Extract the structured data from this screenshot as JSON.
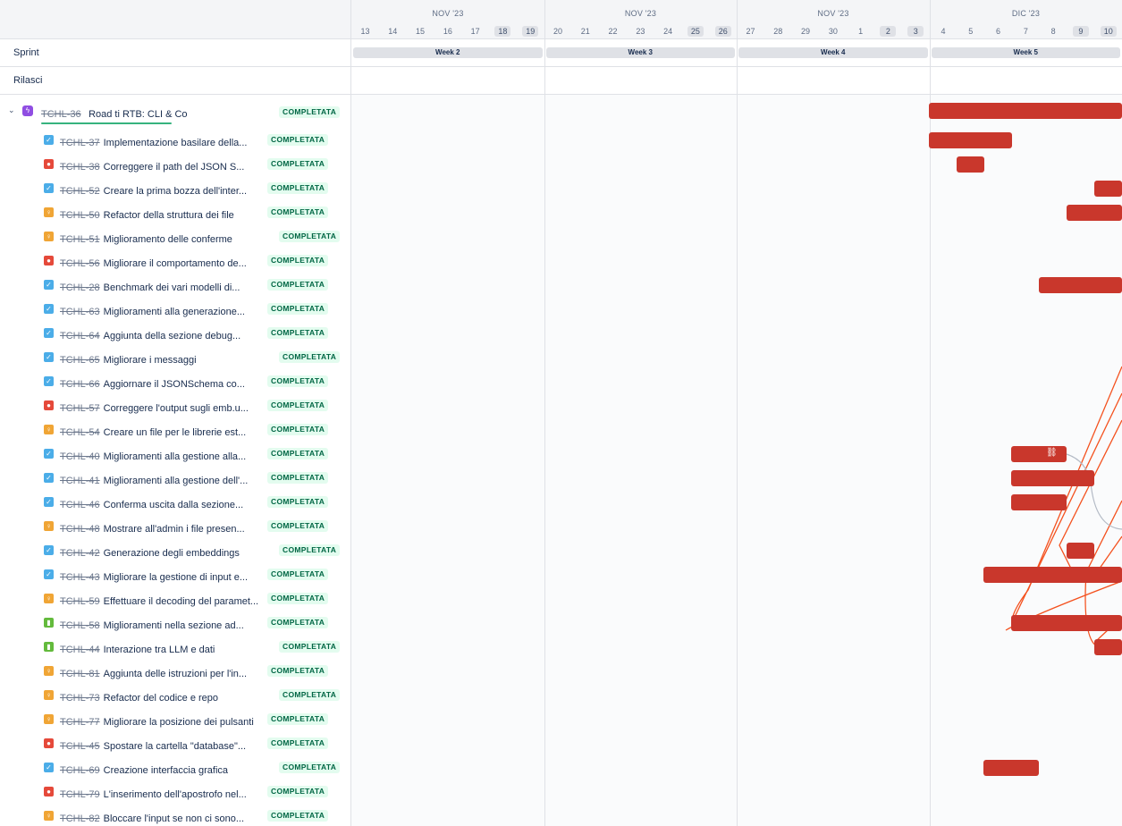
{
  "header": {
    "months": [
      "NOV '23",
      "NOV '23",
      "NOV '23",
      "DIC '23"
    ],
    "days": [
      "13",
      "14",
      "15",
      "16",
      "17",
      "18",
      "19",
      "20",
      "21",
      "22",
      "23",
      "24",
      "25",
      "26",
      "27",
      "28",
      "29",
      "30",
      "1",
      "2",
      "3",
      "4",
      "5",
      "6",
      "7",
      "8",
      "9",
      "10"
    ],
    "weekends": [
      5,
      6,
      12,
      13,
      19,
      20,
      26,
      27
    ]
  },
  "sprint": {
    "label": "Sprint",
    "weeks": [
      "Week 2",
      "Week 3",
      "Week 4",
      "Week 5"
    ]
  },
  "rilasci": {
    "label": "Rilasci"
  },
  "epic": {
    "key": "TCHL-36",
    "summary": "Road ti RTB: CLI & Co",
    "status": "COMPLETATA",
    "icon": "epic-icon",
    "progress_percent": 100
  },
  "status_label": "COMPLETATA",
  "issues": [
    {
      "type": "task",
      "key": "TCHL-37",
      "summary": "Implementazione basilare della..."
    },
    {
      "type": "bug",
      "key": "TCHL-38",
      "summary": "Correggere il path del JSON S..."
    },
    {
      "type": "task",
      "key": "TCHL-52",
      "summary": "Creare la prima bozza dell'inter..."
    },
    {
      "type": "subtask",
      "key": "TCHL-50",
      "summary": "Refactor della struttura dei file"
    },
    {
      "type": "subtask",
      "key": "TCHL-51",
      "summary": "Miglioramento delle conferme"
    },
    {
      "type": "bug",
      "key": "TCHL-56",
      "summary": "Migliorare il comportamento de..."
    },
    {
      "type": "task",
      "key": "TCHL-28",
      "summary": "Benchmark dei vari modelli di..."
    },
    {
      "type": "task",
      "key": "TCHL-63",
      "summary": "Miglioramenti alla generazione..."
    },
    {
      "type": "task",
      "key": "TCHL-64",
      "summary": "Aggiunta della sezione debug..."
    },
    {
      "type": "task",
      "key": "TCHL-65",
      "summary": "Migliorare i messaggi"
    },
    {
      "type": "task",
      "key": "TCHL-66",
      "summary": "Aggiornare il JSONSchema co..."
    },
    {
      "type": "bug",
      "key": "TCHL-57",
      "summary": "Correggere l'output sugli emb.u..."
    },
    {
      "type": "subtask",
      "key": "TCHL-54",
      "summary": "Creare un file per le librerie est..."
    },
    {
      "type": "task",
      "key": "TCHL-40",
      "summary": "Miglioramenti alla gestione alla..."
    },
    {
      "type": "task",
      "key": "TCHL-41",
      "summary": "Miglioramenti alla gestione dell'..."
    },
    {
      "type": "task",
      "key": "TCHL-46",
      "summary": "Conferma uscita dalla sezione..."
    },
    {
      "type": "subtask",
      "key": "TCHL-48",
      "summary": "Mostrare all'admin i file presen..."
    },
    {
      "type": "task",
      "key": "TCHL-42",
      "summary": "Generazione degli embeddings"
    },
    {
      "type": "task",
      "key": "TCHL-43",
      "summary": "Migliorare la gestione di input e..."
    },
    {
      "type": "subtask",
      "key": "TCHL-59",
      "summary": "Effettuare il decoding del paramet..."
    },
    {
      "type": "story",
      "key": "TCHL-58",
      "summary": "Miglioramenti nella sezione ad..."
    },
    {
      "type": "story",
      "key": "TCHL-44",
      "summary": "Interazione tra LLM e dati"
    },
    {
      "type": "subtask",
      "key": "TCHL-81",
      "summary": "Aggiunta delle istruzioni per l'in..."
    },
    {
      "type": "subtask",
      "key": "TCHL-73",
      "summary": "Refactor del codice e repo"
    },
    {
      "type": "subtask",
      "key": "TCHL-77",
      "summary": "Migliorare la posizione dei pulsanti"
    },
    {
      "type": "bug",
      "key": "TCHL-45",
      "summary": "Spostare la cartella \"database\"..."
    },
    {
      "type": "task",
      "key": "TCHL-69",
      "summary": "Creazione interfaccia grafica"
    },
    {
      "type": "bug",
      "key": "TCHL-79",
      "summary": "L'inserimento dell'apostrofo nel..."
    },
    {
      "type": "subtask",
      "key": "TCHL-82",
      "summary": "Bloccare l'input se non ci sono..."
    }
  ],
  "colors": {
    "bar": "#c9372c",
    "dependency_line": "#f4511e",
    "status_bg": "#e3fcef",
    "status_text": "#006644"
  },
  "icons": {
    "task": "checkbox-icon",
    "bug": "bug-icon",
    "subtask": "lightbulb-icon",
    "story": "bookmark-icon",
    "link": "link-icon",
    "chevron": "chevron-down-icon"
  }
}
